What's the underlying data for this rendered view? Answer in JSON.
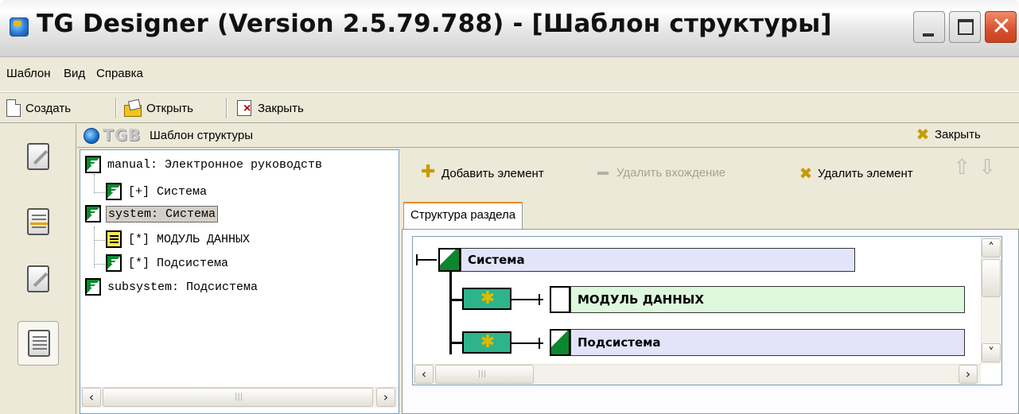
{
  "window": {
    "title": "TG Designer (Version 2.5.79.788) - [Шаблон структуры]"
  },
  "menu": {
    "items": [
      "Шаблон",
      "Вид",
      "Справка"
    ]
  },
  "toolbar": {
    "create_label": "Создать",
    "open_label": "Открыть",
    "close_label": "Закрыть"
  },
  "panel": {
    "logo_text": "TGB",
    "title": "Шаблон структуры",
    "close_label": "Закрыть"
  },
  "tree": {
    "nodes": [
      {
        "text": "manual: Электронное руководств",
        "icon": "green-doc-icon"
      },
      {
        "text": "[+] Система",
        "icon": "green-doc-icon"
      },
      {
        "text": "system: Система",
        "icon": "green-doc-icon",
        "selected": true
      },
      {
        "text": "[*] МОДУЛЬ ДАННЫХ",
        "icon": "yellow-doc-icon"
      },
      {
        "text": "[*] Подсистема",
        "icon": "green-doc-icon"
      },
      {
        "text": "subsystem: Подсистема",
        "icon": "green-doc-icon"
      }
    ]
  },
  "element_toolbar": {
    "add_label": "Добавить элемент",
    "remove_entry_label": "Удалить вхождение",
    "delete_label": "Удалить элемент"
  },
  "tabs": {
    "structure_label": "Структура раздела"
  },
  "structure": {
    "root_label": "Система",
    "children": [
      "МОДУЛЬ ДАННЫХ",
      "Подсистема"
    ]
  },
  "colors": {
    "accent_gold": "#c89a00",
    "node_green": "#0b8a2e",
    "teal": "#2eb38a",
    "lilac": "#e3e3fa",
    "mint": "#ddf8dd"
  }
}
